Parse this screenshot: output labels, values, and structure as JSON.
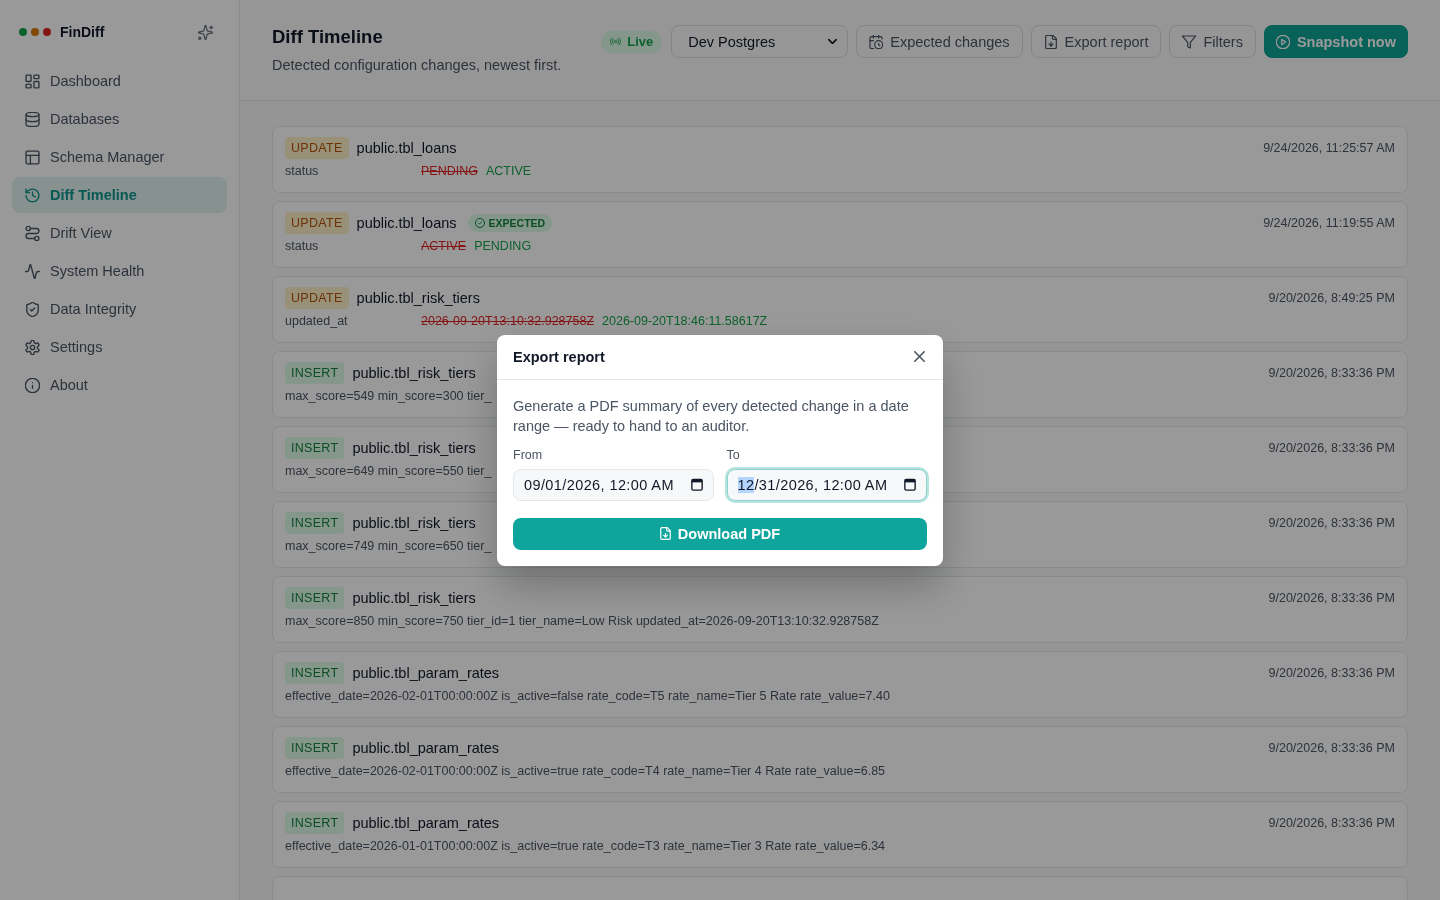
{
  "sidebar": {
    "brand": "FinDiff",
    "items": [
      {
        "label": "Dashboard",
        "selected": false
      },
      {
        "label": "Databases",
        "selected": false
      },
      {
        "label": "Schema Manager",
        "selected": false
      },
      {
        "label": "Diff Timeline",
        "selected": true
      },
      {
        "label": "Drift View",
        "selected": false
      },
      {
        "label": "System Health",
        "selected": false
      },
      {
        "label": "Data Integrity",
        "selected": false
      },
      {
        "label": "Settings",
        "selected": false
      },
      {
        "label": "About",
        "selected": false
      }
    ]
  },
  "header": {
    "title": "Diff Timeline",
    "subtitle": "Detected configuration changes, newest first.",
    "live_badge": {
      "label": "Live"
    },
    "database_select": {
      "value": "Dev Postgres"
    },
    "buttons": [
      {
        "label": "Expected changes",
        "kind": "outline"
      },
      {
        "label": "Export report",
        "kind": "outline"
      },
      {
        "label": "Filters",
        "kind": "outline"
      },
      {
        "label": "Snapshot now",
        "kind": "primary"
      }
    ]
  },
  "events": [
    {
      "kind": "update",
      "op": "UPDATE",
      "table": "public.tbl_loans",
      "time": "9/24/2026, 11:25:57 AM",
      "changes": [
        {
          "field": "status",
          "old": "PENDING",
          "new": "ACTIVE"
        }
      ]
    },
    {
      "kind": "update",
      "op": "UPDATE",
      "table": "public.tbl_loans",
      "tag": {
        "label": "EXPECTED"
      },
      "time": "9/24/2026, 11:19:55 AM",
      "changes": [
        {
          "field": "status",
          "old": "ACTIVE",
          "new": "PENDING"
        }
      ]
    },
    {
      "kind": "update",
      "op": "UPDATE",
      "table": "public.tbl_risk_tiers",
      "time": "9/20/2026, 8:49:25 PM",
      "changes": [
        {
          "field": "updated_at",
          "old": "2026-09-20T13:10:32.928758Z",
          "new": "2026-09-20T18:46:11.58617Z"
        }
      ]
    },
    {
      "kind": "insert",
      "op": "INSERT",
      "table": "public.tbl_risk_tiers",
      "time": "9/20/2026, 8:33:36 PM",
      "values": "max_score=549 min_score=300 tier_"
    },
    {
      "kind": "insert",
      "op": "INSERT",
      "table": "public.tbl_risk_tiers",
      "time": "9/20/2026, 8:33:36 PM",
      "values": "max_score=649 min_score=550 tier_"
    },
    {
      "kind": "insert",
      "op": "INSERT",
      "table": "public.tbl_risk_tiers",
      "time": "9/20/2026, 8:33:36 PM",
      "values": "max_score=749 min_score=650 tier_"
    },
    {
      "kind": "insert",
      "op": "INSERT",
      "table": "public.tbl_risk_tiers",
      "time": "9/20/2026, 8:33:36 PM",
      "values": "max_score=850 min_score=750 tier_id=1 tier_name=Low Risk updated_at=2026-09-20T13:10:32.928758Z"
    },
    {
      "kind": "insert",
      "op": "INSERT",
      "table": "public.tbl_param_rates",
      "time": "9/20/2026, 8:33:36 PM",
      "values": "effective_date=2026-02-01T00:00:00Z is_active=false rate_code=T5 rate_name=Tier 5 Rate rate_value=7.40"
    },
    {
      "kind": "insert",
      "op": "INSERT",
      "table": "public.tbl_param_rates",
      "time": "9/20/2026, 8:33:36 PM",
      "values": "effective_date=2026-02-01T00:00:00Z is_active=true rate_code=T4 rate_name=Tier 4 Rate rate_value=6.85"
    },
    {
      "kind": "insert",
      "op": "INSERT",
      "table": "public.tbl_param_rates",
      "time": "9/20/2026, 8:33:36 PM",
      "values": "effective_date=2026-01-01T00:00:00Z is_active=true rate_code=T3 rate_name=Tier 3 Rate rate_value=6.34"
    }
  ],
  "export_dialog": {
    "title": "Export report",
    "description": "Generate a PDF summary of every detected change in a date range — ready to hand to an auditor.",
    "fields": [
      {
        "label": "From",
        "focused": false,
        "value_segments": [
          {
            "text": "09/01/2026, 12:00 AM",
            "selected": false
          }
        ]
      },
      {
        "label": "To",
        "focused": true,
        "value_segments": [
          {
            "text": "12",
            "selected": true
          },
          {
            "text": "/31/2026, 12:00 AM",
            "selected": false
          }
        ]
      }
    ],
    "download_button": {
      "label": "Download PDF"
    }
  }
}
